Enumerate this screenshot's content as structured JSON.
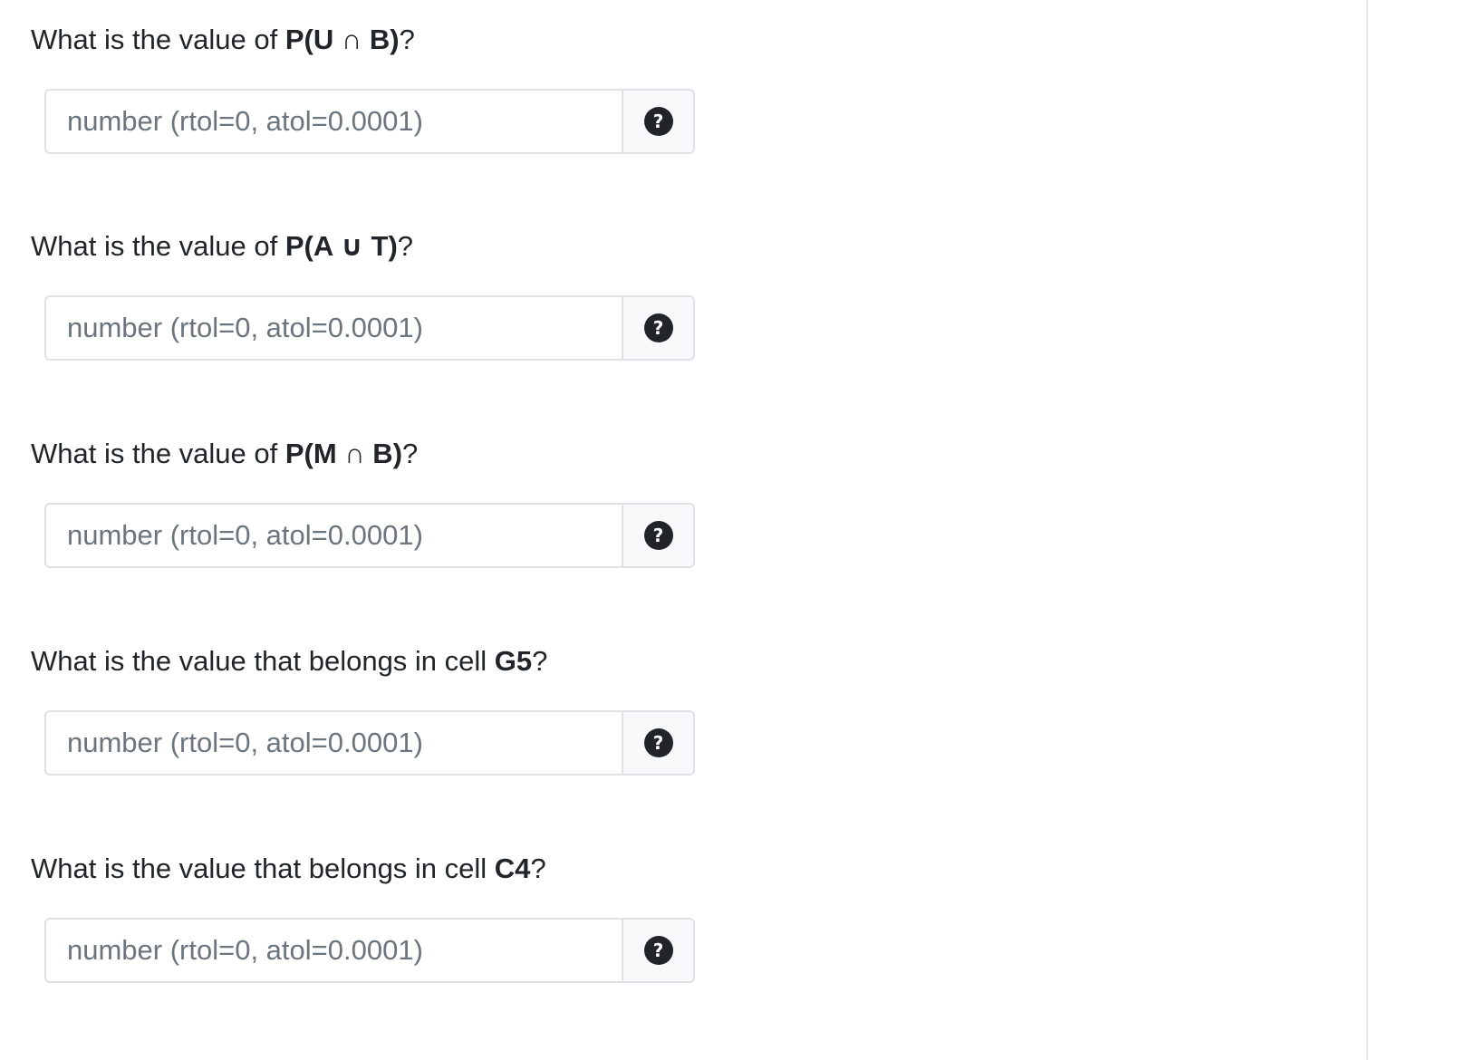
{
  "questions": [
    {
      "prefix": "What is the value of ",
      "bold": "P(U ∩ B)",
      "suffix": "?",
      "placeholder": "number (rtol=0, atol=0.0001)",
      "help_icon": "question-circle-icon"
    },
    {
      "prefix": "What is the value of ",
      "bold": "P(A ∪ T)",
      "suffix": "?",
      "placeholder": "number (rtol=0, atol=0.0001)",
      "help_icon": "question-circle-icon"
    },
    {
      "prefix": "What is the value of ",
      "bold": "P(M ∩ B)",
      "suffix": "?",
      "placeholder": "number (rtol=0, atol=0.0001)",
      "help_icon": "question-circle-icon"
    },
    {
      "prefix": "What is the value that belongs in cell ",
      "bold": "G5",
      "suffix": "?",
      "placeholder": "number (rtol=0, atol=0.0001)",
      "help_icon": "question-circle-icon"
    },
    {
      "prefix": "What is the value that belongs in cell ",
      "bold": "C4",
      "suffix": "?",
      "placeholder": "number (rtol=0, atol=0.0001)",
      "help_icon": "question-circle-icon"
    }
  ],
  "help_glyph": "?",
  "colors": {
    "text": "#212529",
    "placeholder": "#6c757d",
    "border": "#dee2e6",
    "addon_bg": "#f8f9fa",
    "icon_bg": "#212529"
  }
}
